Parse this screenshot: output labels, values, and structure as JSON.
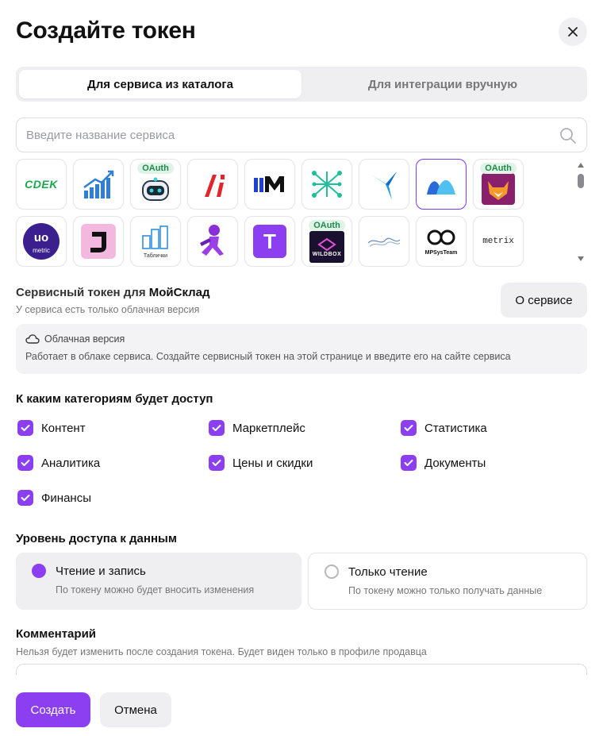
{
  "title": "Создайте токен",
  "tabs": [
    {
      "label": "Для сервиса из каталога",
      "active": true
    },
    {
      "label": "Для интеграции вручную",
      "active": false
    }
  ],
  "search": {
    "placeholder": "Введите название сервиса",
    "value": ""
  },
  "catalog": {
    "badge_label": "OAuth",
    "row1": [
      {
        "name": "cdek",
        "text": "CDEK",
        "oauth": false
      },
      {
        "name": "growth-chart",
        "text": "",
        "oauth": false
      },
      {
        "name": "robot",
        "text": "",
        "oauth": true
      },
      {
        "name": "red-slashes",
        "text": "",
        "oauth": false
      },
      {
        "name": "mm-logo",
        "text": "",
        "oauth": false
      },
      {
        "name": "network",
        "text": "",
        "oauth": false
      },
      {
        "name": "bird",
        "text": "",
        "oauth": false
      },
      {
        "name": "moysklad",
        "text": "",
        "oauth": false,
        "selected": true
      },
      {
        "name": "fox",
        "text": "",
        "oauth": true
      }
    ],
    "row2": [
      {
        "name": "uo-metric",
        "text": "metric",
        "oauth": false
      },
      {
        "name": "j-logo",
        "text": "",
        "oauth": false
      },
      {
        "name": "tablichki",
        "text": "Таблички",
        "oauth": false
      },
      {
        "name": "runner",
        "text": "",
        "oauth": false
      },
      {
        "name": "t-logo",
        "text": "T",
        "oauth": false
      },
      {
        "name": "wildbox",
        "text": "WILDBOX",
        "oauth": true
      },
      {
        "name": "handshake",
        "text": "",
        "oauth": false
      },
      {
        "name": "mpsysteam",
        "text": "MPSysTeam",
        "oauth": false
      },
      {
        "name": "metrix",
        "text": "metrix",
        "oauth": false
      }
    ]
  },
  "service": {
    "title_prefix": "Сервисный токен для",
    "name": "МойСклад",
    "subtitle": "У сервиса есть только облачная версия",
    "about_button": "О сервисе",
    "info_title": "Облачная версия",
    "info_text": "Работает в облаке сервиса. Создайте сервисный токен на этой странице и введите его на сайте сервиса"
  },
  "categories": {
    "heading": "К каким категориям будет доступ",
    "items": [
      {
        "label": "Контент",
        "checked": true
      },
      {
        "label": "Маркетплейс",
        "checked": true
      },
      {
        "label": "Статистика",
        "checked": true
      },
      {
        "label": "Аналитика",
        "checked": true
      },
      {
        "label": "Цены и скидки",
        "checked": true
      },
      {
        "label": "Документы",
        "checked": true
      },
      {
        "label": "Финансы",
        "checked": true
      }
    ]
  },
  "access": {
    "heading": "Уровень доступа к данным",
    "options": [
      {
        "label": "Чтение и запись",
        "desc": "По токену можно будет вносить изменения",
        "selected": true
      },
      {
        "label": "Только чтение",
        "desc": "По токену можно только получать данные",
        "selected": false
      }
    ]
  },
  "comment": {
    "heading": "Комментарий",
    "hint": "Нельзя будет изменить после создания токена. Будет виден только в профиле продавца"
  },
  "buttons": {
    "create": "Создать",
    "cancel": "Отмена"
  },
  "colors": {
    "accent": "#8b3ff0",
    "oauth_bg": "#dff3e6",
    "oauth_text": "#1e8a4c"
  }
}
